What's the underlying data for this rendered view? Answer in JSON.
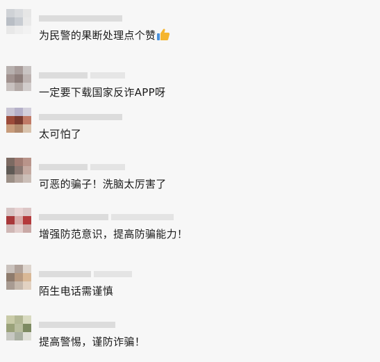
{
  "comments": [
    {
      "text": "为民警的果断处理点个赞",
      "emoji": "thumbs-up-icon",
      "avatar": [
        "#cfd2d6",
        "#d9dbde",
        "#e6e6e6",
        "#b9bec5",
        "#c8ccd2",
        "#e9e9e9",
        "#e8e8e8",
        "#eeeeee",
        "#f2f2f2"
      ]
    },
    {
      "text": "一定要下载国家反诈APP呀",
      "emoji": null,
      "avatar": [
        "#b7b0ae",
        "#a89c9a",
        "#c9c4c3",
        "#a0918e",
        "#8d7d7a",
        "#bdb3b1",
        "#c8c1bf",
        "#b3a9a6",
        "#d2cdcc"
      ]
    },
    {
      "text": "太可怕了",
      "emoji": null,
      "avatar": [
        "#c9c5d4",
        "#b5b0c9",
        "#d3d0dc",
        "#9c4b3a",
        "#7a3b30",
        "#c07a66",
        "#c89c7c",
        "#b18a6e",
        "#d9c3ad"
      ]
    },
    {
      "text": "可恶的骗子！洗脑太厉害了",
      "emoji": null,
      "avatar": [
        "#7c6a62",
        "#a07b72",
        "#b9948a",
        "#5f5a55",
        "#8a7872",
        "#c4a9a0",
        "#9b8f86",
        "#b6a79f",
        "#ccbfb8"
      ]
    },
    {
      "text": "增强防范意识，提高防骗能力！",
      "emoji": null,
      "avatar": [
        "#d7c5c5",
        "#e8d2d2",
        "#dcc6c6",
        "#a8383a",
        "#d6a8a6",
        "#b43a3c",
        "#cfb7b5",
        "#e2cdcb",
        "#c9a9a6"
      ]
    },
    {
      "text": "陌生电话需谨慎",
      "emoji": null,
      "avatar": [
        "#cac2bd",
        "#b0a29a",
        "#ded5ce",
        "#8e7b6d",
        "#b79980",
        "#d9b896",
        "#a89b92",
        "#c5b8ac",
        "#e2d2c2"
      ]
    },
    {
      "text": "提高警惕，谨防诈骗！",
      "emoji": null,
      "avatar": [
        "#c9cba8",
        "#b3b895",
        "#d8dac0",
        "#9aa27a",
        "#b9be9f",
        "#7d8a62",
        "#c7c8c2",
        "#aab0a2",
        "#e0e0d8"
      ]
    }
  ],
  "colors": {
    "background": "#f7f7f7",
    "text": "#1a1a1a",
    "nickname_blur": "#dcdcdc",
    "thumb_skin": "#f5b52e",
    "thumb_cuff": "#4a90d9"
  }
}
